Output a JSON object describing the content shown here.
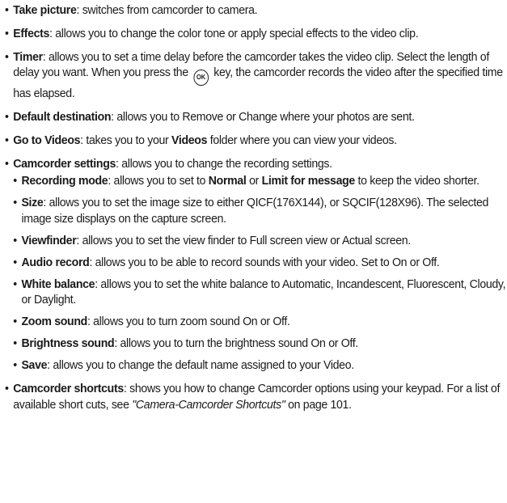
{
  "items": [
    {
      "term": "Take picture",
      "desc": ": switches from camcorder to camera."
    },
    {
      "term": "Effects",
      "desc": ": allows you to change the color tone or apply special effects to the video clip."
    },
    {
      "term": "Timer",
      "desc_before_key": ": allows you to set a time delay before the camcorder takes the video clip. Select the length of delay you want. When you press the",
      "key_label": "OK",
      "desc_after_key": "key, the camcorder records the video after the specified time has elapsed."
    },
    {
      "term": "Default destination",
      "desc": ": allows you to Remove or Change where your photos are sent."
    },
    {
      "term": "Go to Videos",
      "desc_pre": ": takes you to your ",
      "bold": "Videos",
      "desc_post": " folder where you can view your videos."
    },
    {
      "term": "Camcorder settings",
      "desc": ": allows you to change the recording settings."
    },
    {
      "term": "Camcorder shortcuts",
      "desc_pre": ": shows you how to change Camcorder options using your keypad. For a list of available short cuts, see ",
      "italic": "\"Camera-Camcorder Shortcuts\"",
      "desc_post": " on page 101."
    }
  ],
  "camcorder_settings": [
    {
      "term": "Recording mode",
      "desc_pre": ": allows you to set to ",
      "bold1": "Normal",
      "mid": " or ",
      "bold2": "Limit for message",
      "desc_post": " to keep the video shorter."
    },
    {
      "term": "Size",
      "desc": ": allows you to set the image size to either QICF(176X144), or SQCIF(128X96). The selected image size displays on the capture screen."
    },
    {
      "term": "Viewfinder",
      "desc": ": allows you to set the view finder to Full screen view or Actual screen."
    },
    {
      "term": "Audio record",
      "desc": ": allows you to be able to record sounds with your video. Set to On or Off."
    },
    {
      "term": "White balance",
      "desc": ": allows you to set the white balance to Automatic, Incandescent, Fluorescent, Cloudy, or Daylight."
    },
    {
      "term": "Zoom sound",
      "desc": ": allows you to turn zoom sound On or Off."
    },
    {
      "term": "Brightness sound",
      "desc": ": allows you to turn the brightness sound On or Off."
    },
    {
      "term": "Save",
      "desc": ": allows you to change the default name assigned to your Video."
    }
  ]
}
